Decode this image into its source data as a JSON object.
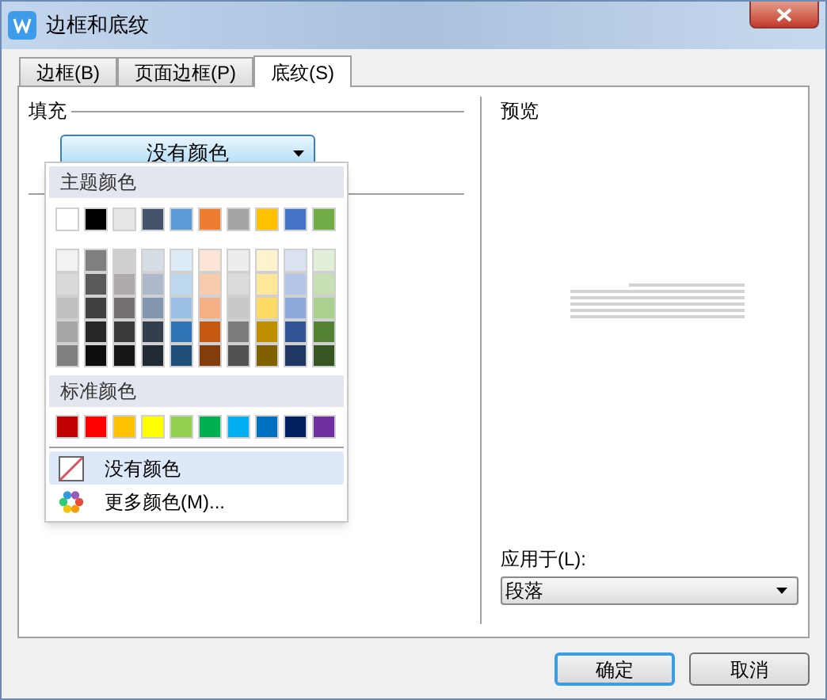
{
  "window": {
    "title": "边框和底纹"
  },
  "tabs": [
    {
      "label": "边框(B)",
      "selected": false
    },
    {
      "label": "页面边框(P)",
      "selected": false
    },
    {
      "label": "底纹(S)",
      "selected": true
    }
  ],
  "fill": {
    "label": "填充",
    "dropdown": {
      "value": "没有颜色"
    }
  },
  "color_menu": {
    "theme_heading": "主题颜色",
    "theme_colors": [
      {
        "color": "#ffffff"
      },
      {
        "color": "#000000"
      },
      {
        "color": "#e7e6e6"
      },
      {
        "color": "#44546a"
      },
      {
        "color": "#5b9bd5"
      },
      {
        "color": "#ed7d31"
      },
      {
        "color": "#a5a5a5"
      },
      {
        "color": "#ffc000"
      },
      {
        "color": "#4472c4"
      },
      {
        "color": "#70ad47"
      }
    ],
    "shade_rows": [
      [
        {
          "color": "#f2f2f2"
        },
        {
          "color": "#7f7f7f"
        },
        {
          "color": "#d0cece"
        },
        {
          "color": "#d6dce4"
        },
        {
          "color": "#ddebf7"
        },
        {
          "color": "#fce4d6"
        },
        {
          "color": "#ededed"
        },
        {
          "color": "#fff2cc"
        },
        {
          "color": "#d9e1f2"
        },
        {
          "color": "#e2efda"
        }
      ],
      [
        {
          "color": "#d9d9d9"
        },
        {
          "color": "#595959"
        },
        {
          "color": "#aeaaaa"
        },
        {
          "color": "#adb9ca"
        },
        {
          "color": "#bdd7ee"
        },
        {
          "color": "#f8cbad"
        },
        {
          "color": "#dbdbdb"
        },
        {
          "color": "#ffe699"
        },
        {
          "color": "#b4c6e7"
        },
        {
          "color": "#c6e0b4"
        }
      ],
      [
        {
          "color": "#bfbfbf"
        },
        {
          "color": "#404040"
        },
        {
          "color": "#757171"
        },
        {
          "color": "#8497b0"
        },
        {
          "color": "#9bc2e6"
        },
        {
          "color": "#f4b084"
        },
        {
          "color": "#c9c9c9"
        },
        {
          "color": "#ffd966"
        },
        {
          "color": "#8ea9db"
        },
        {
          "color": "#a9d08e"
        }
      ],
      [
        {
          "color": "#a6a6a6"
        },
        {
          "color": "#262626"
        },
        {
          "color": "#3a3838"
        },
        {
          "color": "#333f4f"
        },
        {
          "color": "#2f75b5"
        },
        {
          "color": "#c65911"
        },
        {
          "color": "#7b7b7b"
        },
        {
          "color": "#bf8f00"
        },
        {
          "color": "#305496"
        },
        {
          "color": "#548235"
        }
      ],
      [
        {
          "color": "#808080"
        },
        {
          "color": "#0d0d0d"
        },
        {
          "color": "#171616"
        },
        {
          "color": "#222a35"
        },
        {
          "color": "#1f4e78"
        },
        {
          "color": "#833c0c"
        },
        {
          "color": "#525252"
        },
        {
          "color": "#806000"
        },
        {
          "color": "#203764"
        },
        {
          "color": "#375623"
        }
      ]
    ],
    "standard_heading": "标准颜色",
    "standard_colors": [
      {
        "color": "#c00000"
      },
      {
        "color": "#ff0000"
      },
      {
        "color": "#ffc000"
      },
      {
        "color": "#ffff00"
      },
      {
        "color": "#92d050"
      },
      {
        "color": "#00b050"
      },
      {
        "color": "#00b0f0"
      },
      {
        "color": "#0070c0"
      },
      {
        "color": "#002060"
      },
      {
        "color": "#7030a0"
      }
    ],
    "items": [
      {
        "kind": "none",
        "label": "没有颜色",
        "selected": true
      },
      {
        "kind": "more",
        "label": "更多颜色(M)...",
        "selected": false
      }
    ]
  },
  "preview": {
    "label": "预览"
  },
  "apply_to": {
    "label": "应用于(L):",
    "value": "段落"
  },
  "buttons": [
    {
      "label": "确定",
      "default": true
    },
    {
      "label": "取消",
      "default": false
    }
  ]
}
